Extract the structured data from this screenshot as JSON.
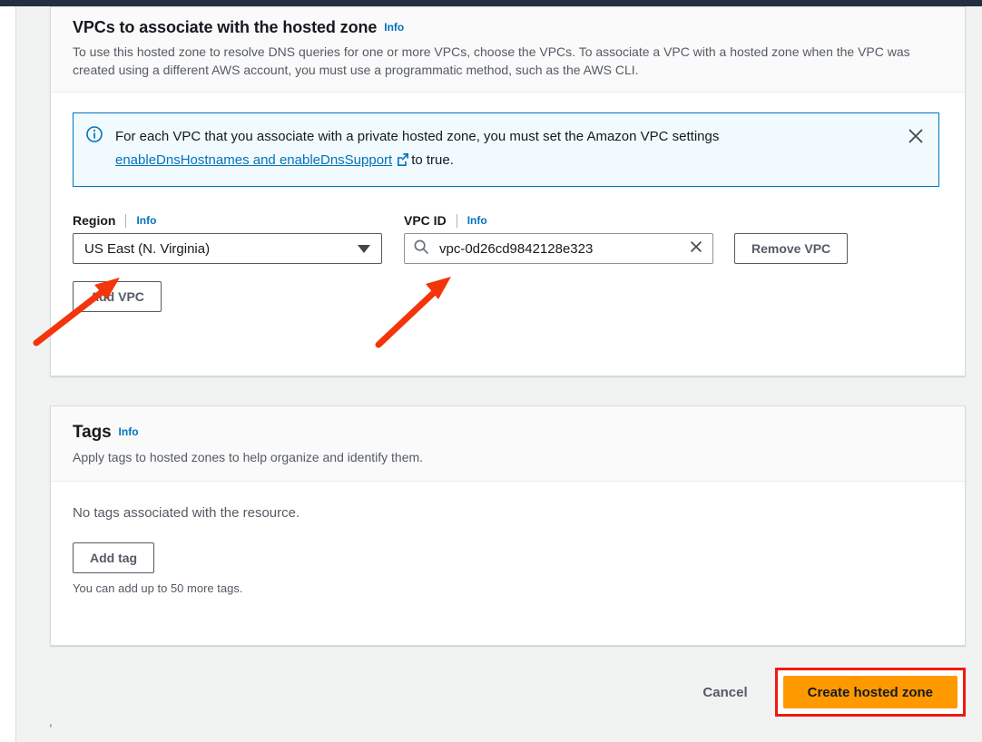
{
  "vpc_section": {
    "title": "VPCs to associate with the hosted zone",
    "info_label": "Info",
    "description": "To use this hosted zone to resolve DNS queries for one or more VPCs, choose the VPCs. To associate a VPC with a hosted zone when the VPC was created using a different AWS account, you must use a programmatic method, such as the AWS CLI.",
    "alert": {
      "icon": "info-circle-icon",
      "text_before": "For each VPC that you associate with a private hosted zone, you must set the Amazon VPC settings",
      "link_text": "enableDnsHostnames and enableDnsSupport",
      "external_icon": "external-link-icon",
      "text_after": "to true.",
      "close_icon": "close-icon",
      "border_color": "#0073bb",
      "background_color": "#f1faff"
    },
    "region_field": {
      "label": "Region",
      "info_label": "Info",
      "value": "US East (N. Virginia)",
      "caret_icon": "chevron-down-icon"
    },
    "vpc_id_field": {
      "label": "VPC ID",
      "info_label": "Info",
      "value": "vpc-0d26cd9842128e323",
      "search_icon": "search-icon",
      "clear_icon": "clear-icon"
    },
    "remove_vpc_button": "Remove VPC",
    "add_vpc_button": "Add VPC"
  },
  "tags_section": {
    "title": "Tags",
    "info_label": "Info",
    "description": "Apply tags to hosted zones to help organize and identify them.",
    "empty_text": "No tags associated with the resource.",
    "add_tag_button": "Add tag",
    "hint": "You can add up to 50 more tags."
  },
  "footer": {
    "cancel_label": "Cancel",
    "create_label": "Create hosted zone",
    "primary_color": "#ff9900",
    "highlight_color": "#f01b0e"
  },
  "annotations": {
    "arrow_color": "#f4340b",
    "arrow_region_target": "region-dropdown",
    "arrow_vpc_target": "vpc-id-input",
    "stray_mark": ","
  }
}
